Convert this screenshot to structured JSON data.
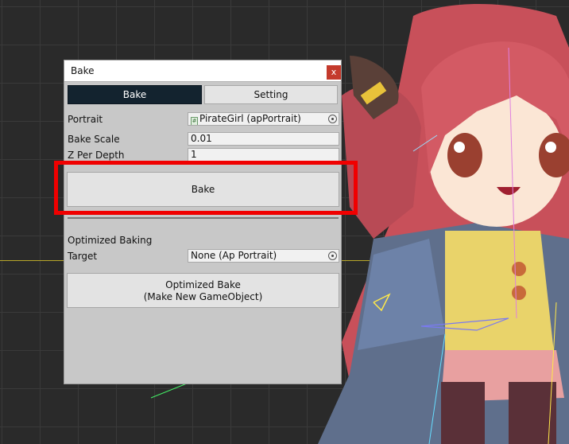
{
  "dialog": {
    "title": "Bake",
    "close_label": "x",
    "tabs": [
      {
        "label": "Bake",
        "active": true
      },
      {
        "label": "Setting",
        "active": false
      }
    ],
    "portrait": {
      "label": "Portrait",
      "value": "PirateGirl (apPortrait)",
      "icon": "object-icon"
    },
    "bake_scale": {
      "label": "Bake Scale",
      "value": "0.01"
    },
    "z_per_depth": {
      "label": "Z Per Depth",
      "value": "1"
    },
    "bake_button_label": "Bake",
    "optimized": {
      "section_label": "Optimized Baking",
      "target_label": "Target",
      "target_value": "None (Ap Portrait)",
      "button_line1": "Optimized Bake",
      "button_line2": "(Make New GameObject)"
    }
  },
  "colors": {
    "active_tab": "#13232f",
    "highlight": "#f00000",
    "close_button": "#c43a2c",
    "canvas_bg": "#2a2a2a"
  }
}
